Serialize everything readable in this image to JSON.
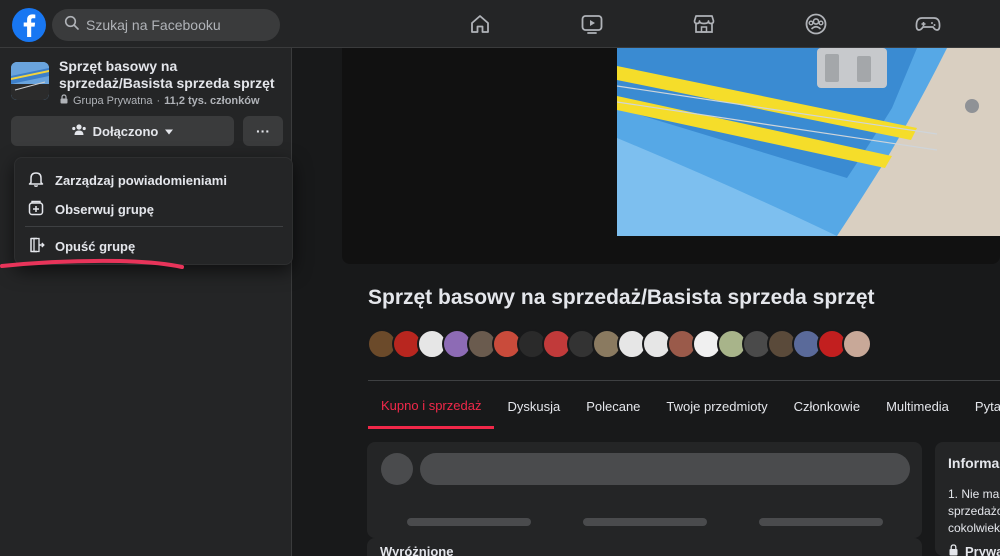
{
  "colors": {
    "accent": "#f02849",
    "brand": "#1877f2",
    "background": "#18191a",
    "surface": "#242526"
  },
  "header": {
    "logo_icon": "facebook-logo-icon",
    "search_placeholder": "Szukaj na Facebooku",
    "nav_icons": [
      "home-icon",
      "watch-icon",
      "marketplace-icon",
      "groups-icon",
      "gaming-icon"
    ]
  },
  "sidebar": {
    "group_name": "Sprzęt basowy na sprzedaż/Basista sprzeda sprzęt",
    "privacy": "Grupa Prywatna",
    "separator": "·",
    "members": "11,2 tys. członków",
    "joined_label": "Dołączono",
    "more_label": "···"
  },
  "menu": {
    "items": [
      {
        "label": "Zarządzaj powiadomieniami",
        "icon": "bell-icon"
      },
      {
        "label": "Obserwuj grupę",
        "icon": "follow-icon"
      },
      {
        "label": "Opuść grupę",
        "icon": "leave-icon"
      }
    ]
  },
  "main": {
    "title": "Sprzęt basowy na sprzedaż/Basista sprzeda sprzęt",
    "tabs": [
      {
        "label": "Kupno i sprzedaż",
        "active": true
      },
      {
        "label": "Dyskusja",
        "active": false
      },
      {
        "label": "Polecane",
        "active": false
      },
      {
        "label": "Twoje przedmioty",
        "active": false
      },
      {
        "label": "Członkowie",
        "active": false
      },
      {
        "label": "Multimedia",
        "active": false
      },
      {
        "label": "Pytania",
        "active": false
      }
    ],
    "featured_label": "Wyróżnione",
    "avatar_colors": [
      "#6b4a2a",
      "#b8261f",
      "#e6e6e6",
      "#8d6bb5",
      "#6a5b4e",
      "#c94b3b",
      "#2a2a2a",
      "#c13a3a",
      "#333333",
      "#8a7a60",
      "#e6e6e6",
      "#e6e6e6",
      "#9a5a4a",
      "#f0f0f0",
      "#a8b48a",
      "#4a4a4a",
      "#5a4a3a",
      "#5a6a9a",
      "#c21f1f",
      "#c8a898"
    ]
  },
  "info": {
    "title": "Informacje",
    "text_lines": [
      "1. Nie ma",
      "sprzedażo",
      "cokolwiek"
    ],
    "privacy_label": "Prywatna"
  }
}
